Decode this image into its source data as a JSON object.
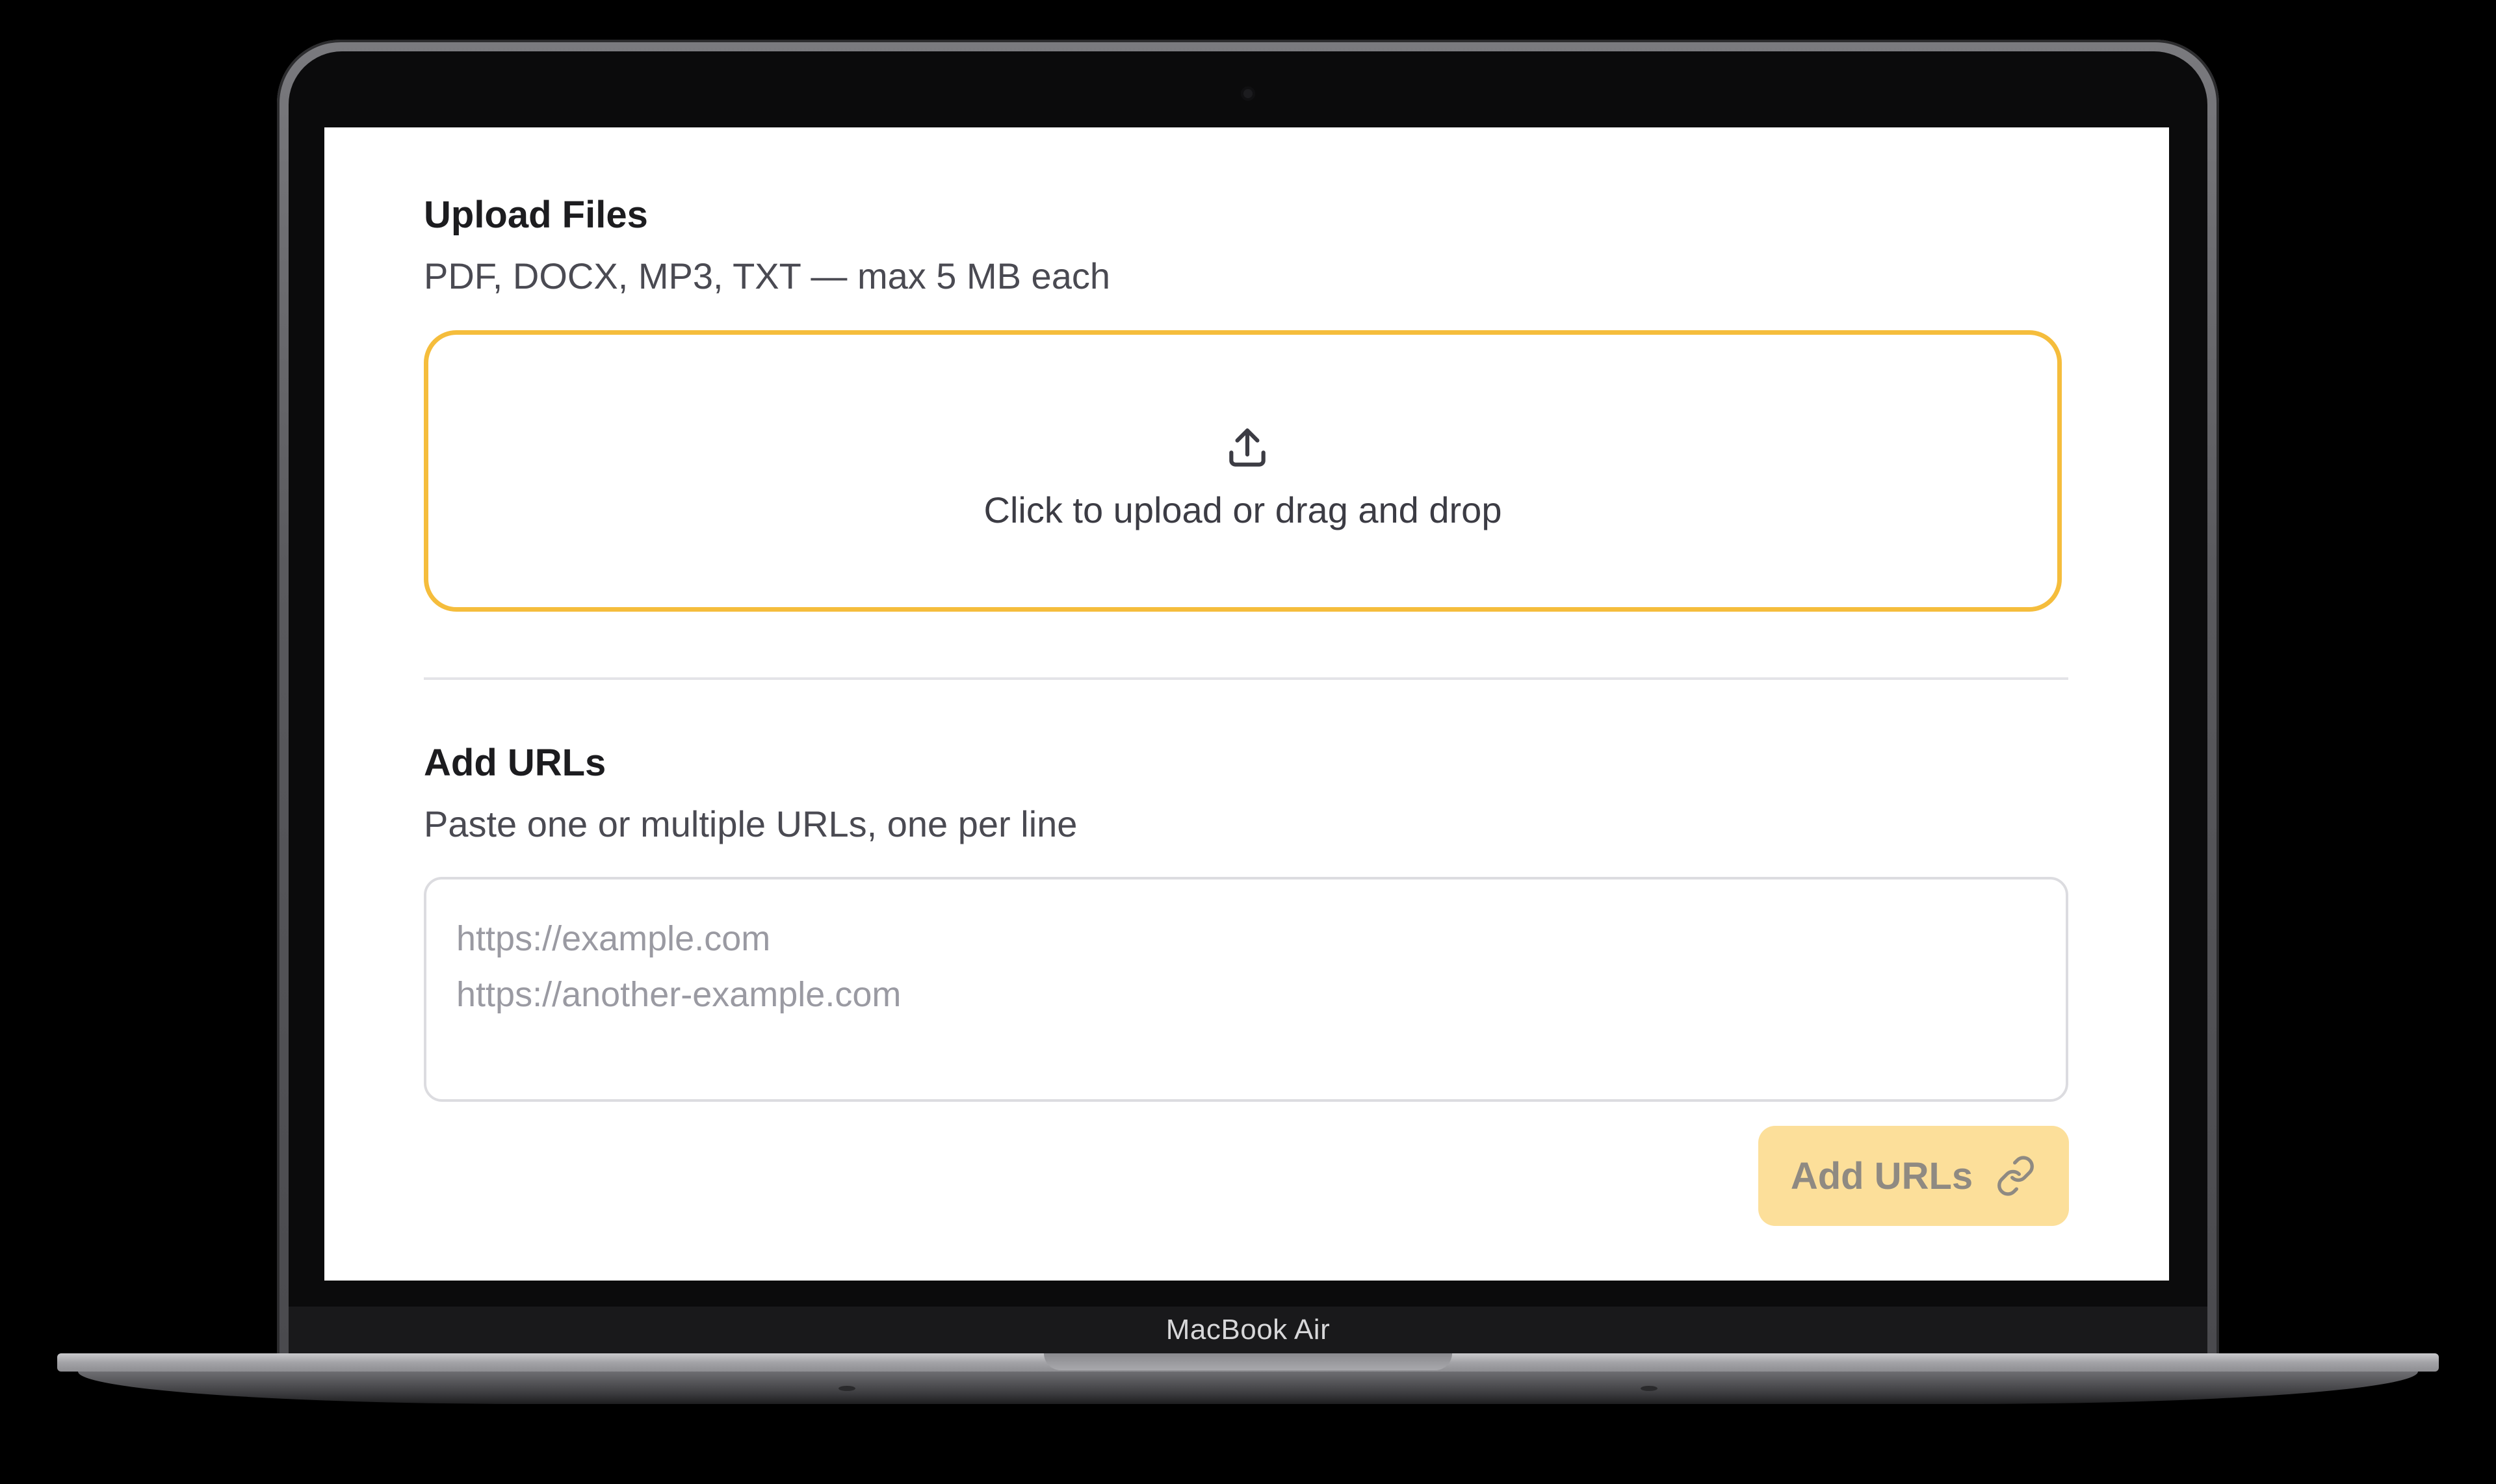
{
  "device": {
    "label": "MacBook Air"
  },
  "upload": {
    "title": "Upload Files",
    "subtitle": "PDF, DOCX, MP3, TXT — max 5 MB each",
    "dropzone_text": "Click to upload or drag and drop",
    "icon": "upload-icon"
  },
  "urls": {
    "title": "Add URLs",
    "subtitle": "Paste one or multiple URLs, one per line",
    "placeholder": "https://example.com\nhttps://another-example.com",
    "button_label": "Add URLs",
    "button_icon": "link-icon"
  },
  "colors": {
    "accent": "#f5bd3c",
    "button_disabled": "#fcdf9a",
    "divider": "#e4e4e8"
  }
}
